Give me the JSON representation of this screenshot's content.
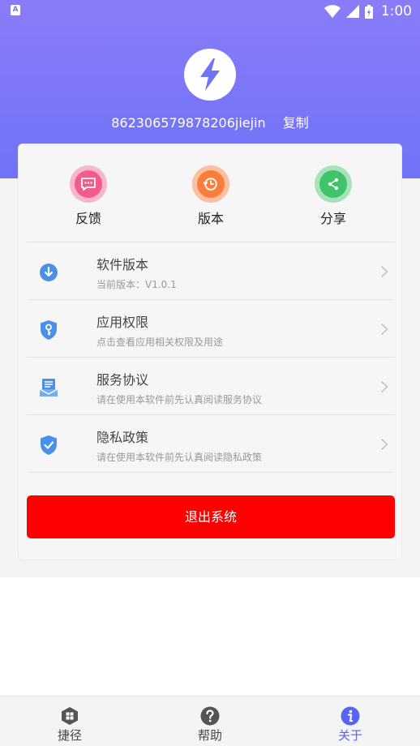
{
  "status_bar": {
    "time": "1:00",
    "app_icon_letter": "A"
  },
  "header": {
    "device_id": "862306579878206jiejin",
    "copy_label": "复制"
  },
  "quick_actions": [
    {
      "label": "反馈",
      "icon": "feedback-icon",
      "color": "#f35b8e",
      "ring": "#f8b6cc"
    },
    {
      "label": "版本",
      "icon": "version-icon",
      "color": "#fa7d3c",
      "ring": "#fbc09f"
    },
    {
      "label": "分享",
      "icon": "share-icon",
      "color": "#3fc46b",
      "ring": "#a8e2ba"
    }
  ],
  "menu": [
    {
      "title": "软件版本",
      "subtitle": "当前版本：V1.0.1",
      "icon": "download-circle-icon"
    },
    {
      "title": "应用权限",
      "subtitle": "点击查看应用相关权限及用途",
      "icon": "shield-key-icon"
    },
    {
      "title": "服务协议",
      "subtitle": "请在使用本软件前先认真阅读服务协议",
      "icon": "agreement-icon"
    },
    {
      "title": "隐私政策",
      "subtitle": "请在使用本软件前先认真阅读隐私政策",
      "icon": "shield-check-icon"
    }
  ],
  "logout_label": "退出系统",
  "bottom_nav": [
    {
      "label": "捷径",
      "icon": "shortcut-icon",
      "active": false
    },
    {
      "label": "帮助",
      "icon": "help-icon",
      "active": false
    },
    {
      "label": "关于",
      "icon": "info-icon",
      "active": true
    }
  ],
  "colors": {
    "header": "#7a77f7",
    "accent_blue": "#4a90e8",
    "logout": "#ff0000",
    "nav_active": "#5864f4"
  }
}
